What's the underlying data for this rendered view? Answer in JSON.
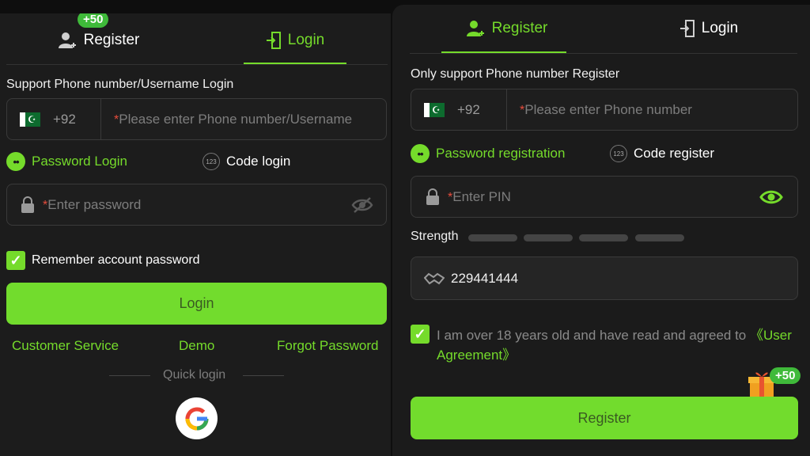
{
  "login_panel": {
    "tabs": {
      "register": "Register",
      "login": "Login",
      "register_badge": "+50"
    },
    "section_label": "Support Phone number/Username Login",
    "phone": {
      "country_code": "+92",
      "required_mark": "*",
      "placeholder": "Please enter Phone number/Username"
    },
    "options": {
      "password_login": "Password Login",
      "code_login": "Code login"
    },
    "password": {
      "required_mark": "*",
      "placeholder": "Enter password"
    },
    "remember": "Remember account password",
    "login_button": "Login",
    "links": {
      "customer_service": "Customer Service",
      "demo": "Demo",
      "forgot_password": "Forgot Password"
    },
    "quick_login": "Quick login"
  },
  "register_panel": {
    "tabs": {
      "register": "Register",
      "login": "Login"
    },
    "section_label": "Only support Phone number Register",
    "phone": {
      "country_code": "+92",
      "required_mark": "*",
      "placeholder": "Please enter Phone number"
    },
    "options": {
      "password_registration": "Password registration",
      "code_register": "Code register"
    },
    "pin": {
      "required_mark": "*",
      "placeholder": "Enter PIN"
    },
    "strength_label": "Strength",
    "invite_code": "229441444",
    "agreement": {
      "text": "I am over 18 years old and have read and agreed to ",
      "link": "《User Agreement》"
    },
    "gift_badge": "+50",
    "register_button": "Register"
  },
  "colors": {
    "accent": "#75db2b",
    "panel_bg": "#1c1c1c",
    "badge": "#3fba3a"
  }
}
